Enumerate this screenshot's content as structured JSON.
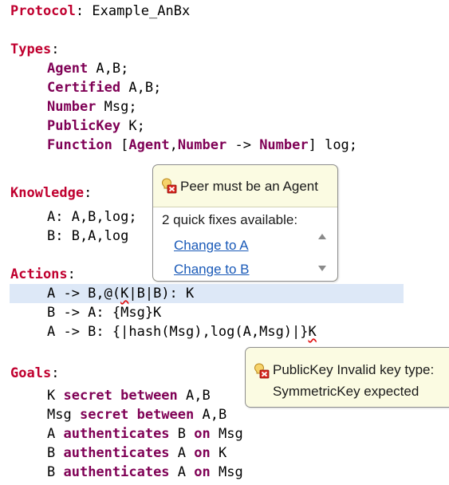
{
  "code": {
    "l1": {
      "kw": "Protocol",
      "rest": ": Example_AnBx"
    },
    "types": {
      "kw": "Types",
      "rest": ":"
    },
    "t1": {
      "kw": "Agent",
      "rest": " A,B;"
    },
    "t2": {
      "kw": "Certified",
      "rest": " A,B;"
    },
    "t3": {
      "kw": "Number",
      "rest": " Msg;"
    },
    "t4": {
      "kw": "PublicKey",
      "rest": " K;"
    },
    "t5": {
      "kw": "Function",
      "p1": " [",
      "a1": "Agent",
      "p2": ",",
      "a2": "Number",
      "p3": " -> ",
      "a3": "Number",
      "p4": "] log;"
    },
    "knowledge": {
      "kw": "Knowledge",
      "rest": ":"
    },
    "k1": "A: A,B,log;",
    "k2": "B: B,A,log",
    "actions": {
      "kw": "Actions",
      "rest": ":"
    },
    "a1": {
      "p1": "A -> B,@(",
      "err": "K",
      "p2": "|B|B): K"
    },
    "a2": "B -> A: {Msg}K",
    "a3": {
      "p1": "A -> B: {|hash(Msg),log(A,Msg)|}",
      "err": "K"
    },
    "goals": {
      "kw": "Goals",
      "rest": ":"
    },
    "g1": {
      "p1": "K ",
      "kw": "secret between",
      "p2": " A,B"
    },
    "g2": {
      "p1": "Msg ",
      "kw": "secret between",
      "p2": " A,B"
    },
    "g3": {
      "p1": "A ",
      "kw1": "authenticates",
      "p2": " B ",
      "kw2": "on",
      "p3": " Msg"
    },
    "g4": {
      "p1": "B ",
      "kw1": "authenticates",
      "p2": " A ",
      "kw2": "on",
      "p3": " K"
    },
    "g5": {
      "p1": "B ",
      "kw1": "authenticates",
      "p2": " A ",
      "kw2": "on",
      "p3": " Msg"
    }
  },
  "quickfix": {
    "message": "Peer must be an Agent",
    "count": "2 quick fixes available:",
    "fixes": [
      "Change to A",
      "Change to B"
    ],
    "icon": "error-bulb-icon"
  },
  "tooltip": {
    "line1": "PublicKey Invalid key type:",
    "line2": "SymmetricKey expected",
    "icon": "error-bulb-icon"
  },
  "colors": {
    "section_keyword": "#c0002f",
    "keyword": "#7f0055",
    "link": "#1a5ab8",
    "popup_bg": "#fbfbe2",
    "line_highlight": "#dde8f7",
    "error_underline": "#e01010"
  }
}
